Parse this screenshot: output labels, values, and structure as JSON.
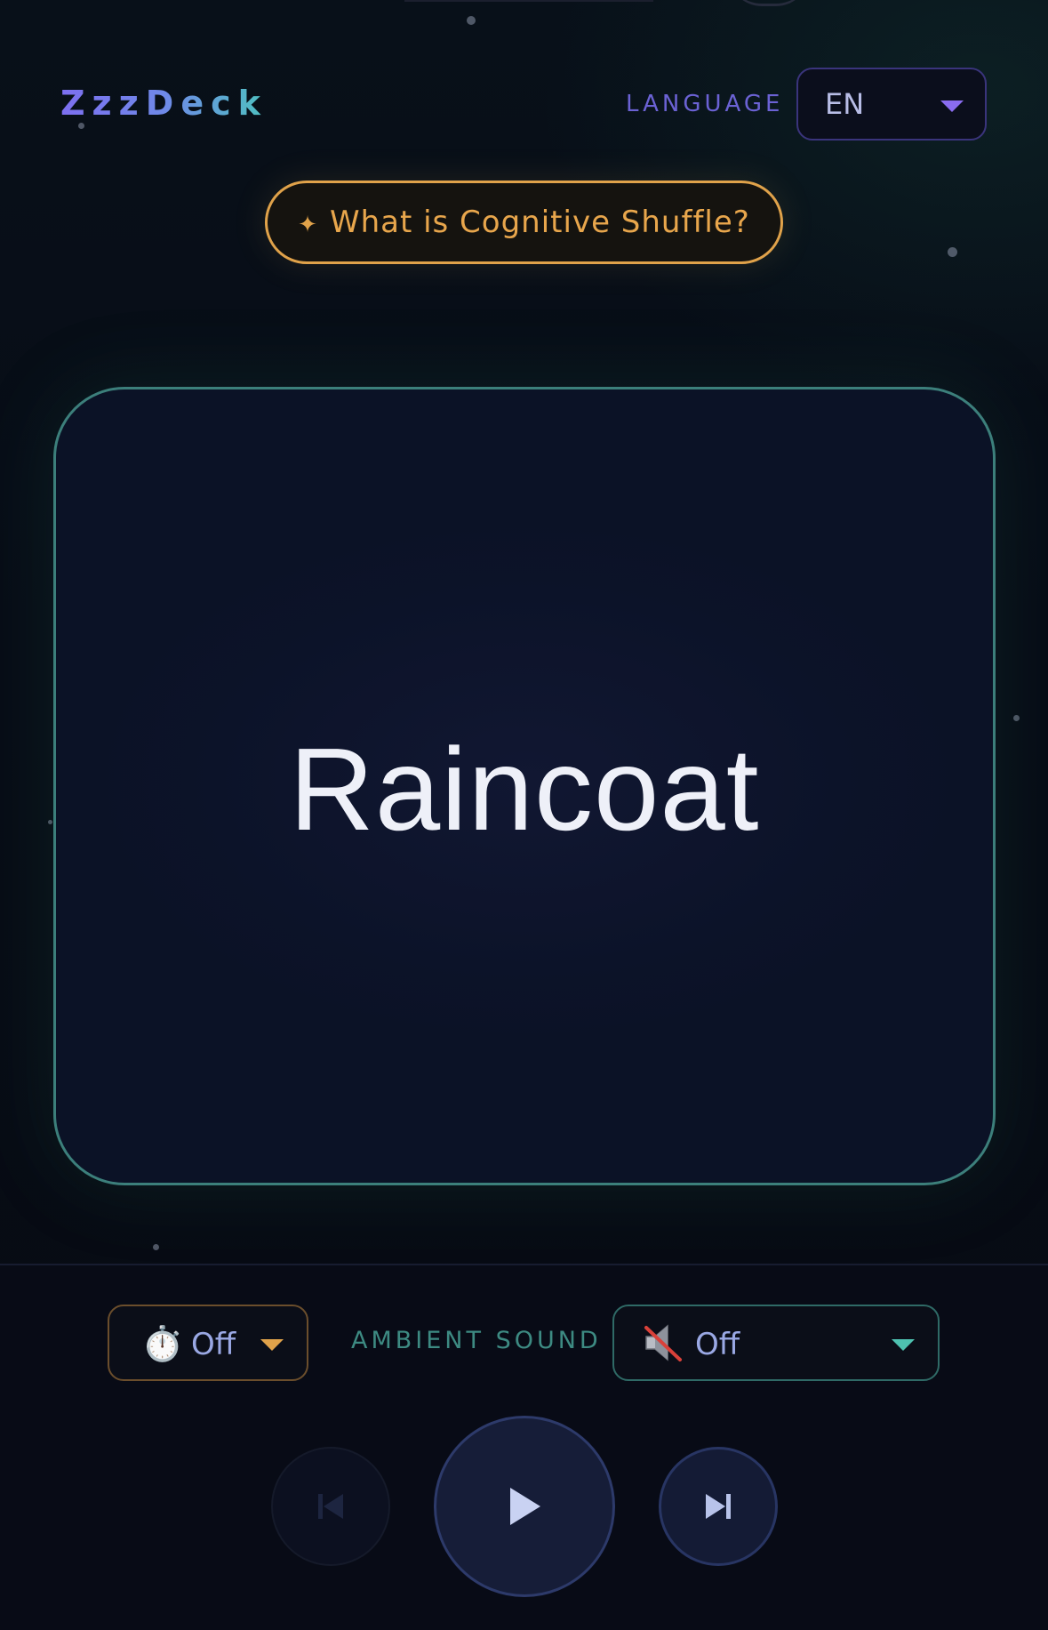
{
  "app": {
    "logo": "ZzzDeck"
  },
  "header": {
    "language_label": "LANGUAGE",
    "language_value": "EN"
  },
  "info_button": {
    "icon": "sparkle-icon",
    "label": "What is Cognitive Shuffle?"
  },
  "card": {
    "word": "Raincoat"
  },
  "controls": {
    "timer": {
      "icon": "stopwatch-icon",
      "value": "Off"
    },
    "ambient_sound_label": "AMBIENT SOUND",
    "sound": {
      "icon": "muted-speaker-icon",
      "value": "Off"
    },
    "playback": {
      "previous_icon": "skip-previous-icon",
      "play_icon": "play-icon",
      "next_icon": "skip-next-icon"
    }
  },
  "colors": {
    "accent_purple": "#7d6ff0",
    "accent_teal": "#4ec1c0",
    "accent_orange": "#e0a24a",
    "background": "#070b14",
    "card_border": "#3c7f7b"
  }
}
